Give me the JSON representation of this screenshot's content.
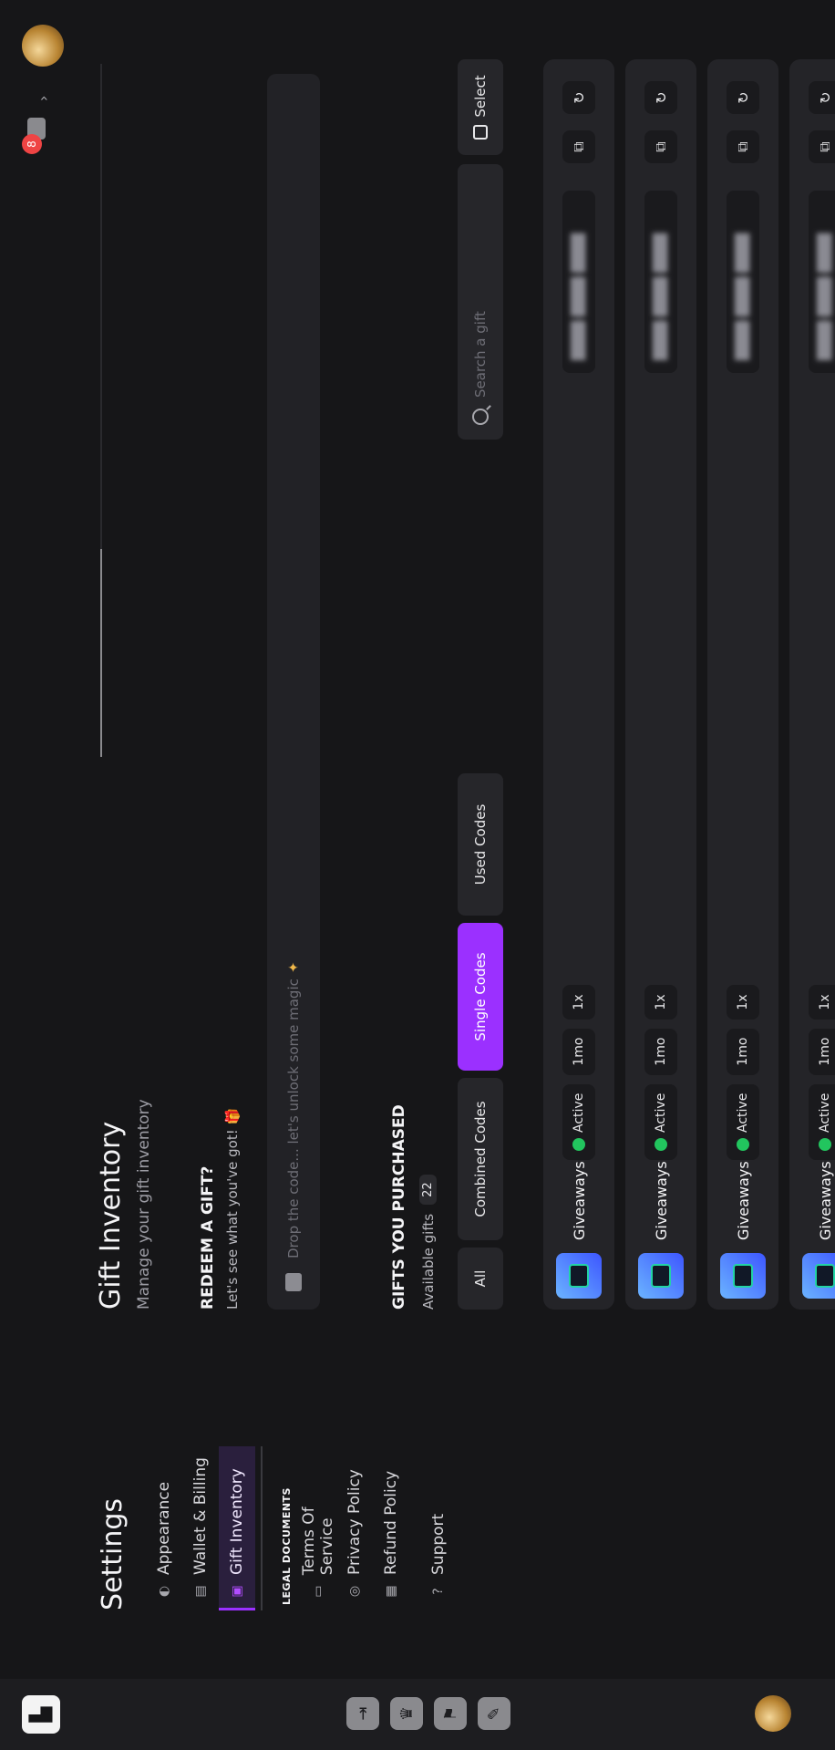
{
  "rail": {
    "icons": [
      "logo-icon",
      "door-icon",
      "crown-icon",
      "flag-icon",
      "wrench-icon"
    ]
  },
  "settings": {
    "title": "Settings",
    "items": [
      {
        "label": "Appearance",
        "icon": "palette-icon"
      },
      {
        "label": "Wallet & Billing",
        "icon": "wallet-icon"
      },
      {
        "label": "Gift Inventory",
        "icon": "gift-icon",
        "active": true
      }
    ],
    "legal_caption": "LEGAL DOCUMENTS",
    "legal_items": [
      {
        "label": "Terms Of Service",
        "icon": "document-icon"
      },
      {
        "label": "Privacy Policy",
        "icon": "fingerprint-icon"
      },
      {
        "label": "Refund Policy",
        "icon": "money-icon"
      }
    ],
    "support_label": "Support"
  },
  "main": {
    "title": "Gift Inventory",
    "subtitle": "Manage your gift inventory",
    "redeem_title": "REDEEM A GIFT?",
    "redeem_subtitle": "Let's see what you've got! 🎁",
    "redeem_placeholder": "Drop the code... let's unlock some magic",
    "gifts_title": "GIFTS YOU PURCHASED",
    "available_label": "Available gifts",
    "available_count": "22",
    "filters": [
      "All",
      "Combined Codes",
      "Single Codes",
      "Used Codes"
    ],
    "active_filter": "Single Codes",
    "search_placeholder": "Search a gift",
    "select_label": "Select"
  },
  "rows": [
    {
      "name": "Giveaways",
      "status": "Active",
      "duration": "1mo",
      "uses": "1x"
    },
    {
      "name": "Giveaways",
      "status": "Active",
      "duration": "1mo",
      "uses": "1x"
    },
    {
      "name": "Giveaways",
      "status": "Active",
      "duration": "1mo",
      "uses": "1x"
    },
    {
      "name": "Giveaways",
      "status": "Active",
      "duration": "1mo",
      "uses": "1x"
    }
  ],
  "header": {
    "notification_count": "8"
  },
  "colors": {
    "accent": "#9b30ff",
    "active_dot": "#22c55e",
    "badge": "#ef4444"
  }
}
